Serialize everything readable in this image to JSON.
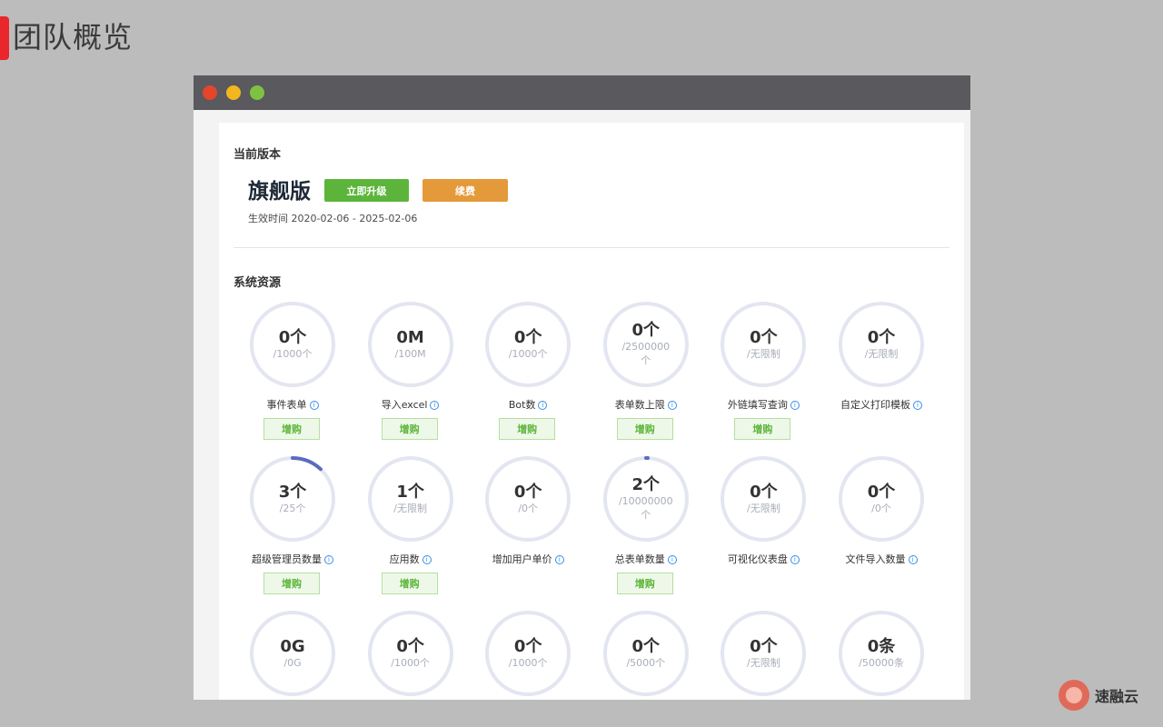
{
  "slide": {
    "title": "团队概览"
  },
  "edition": {
    "section_title": "当前版本",
    "name": "旗舰版",
    "upgrade_label": "立即升级",
    "renew_label": "续费",
    "effective": "生效时间 2020-02-06 - 2025-02-06"
  },
  "resources": {
    "section_title": "系统资源",
    "buy_label": "增购",
    "info_icon": "ⓘ",
    "items": [
      {
        "value": "0个",
        "limit": "/1000个",
        "label": "事件表单",
        "buy": true,
        "progress": 0
      },
      {
        "value": "0M",
        "limit": "/100M",
        "label": "导入excel",
        "buy": true,
        "progress": 0
      },
      {
        "value": "0个",
        "limit": "/1000个",
        "label": "Bot数",
        "buy": true,
        "progress": 0
      },
      {
        "value": "0个",
        "limit": "/2500000个",
        "label": "表单数上限",
        "buy": true,
        "progress": 0
      },
      {
        "value": "0个",
        "limit": "/无限制",
        "label": "外链填写查询",
        "buy": true,
        "progress": 0
      },
      {
        "value": "0个",
        "limit": "/无限制",
        "label": "自定义打印模板",
        "buy": false,
        "progress": 0
      },
      {
        "value": "3个",
        "limit": "/25个",
        "label": "超级管理员数量",
        "buy": true,
        "progress": 0.12
      },
      {
        "value": "1个",
        "limit": "/无限制",
        "label": "应用数",
        "buy": true,
        "progress": 0
      },
      {
        "value": "0个",
        "limit": "/0个",
        "label": "增加用户单价",
        "buy": false,
        "progress": 0
      },
      {
        "value": "2个",
        "limit": "/10000000个",
        "label": "总表单数量",
        "buy": true,
        "progress": 0.002
      },
      {
        "value": "0个",
        "limit": "/无限制",
        "label": "可视化仪表盘",
        "buy": false,
        "progress": 0
      },
      {
        "value": "0个",
        "limit": "/0个",
        "label": "文件导入数量",
        "buy": false,
        "progress": 0
      },
      {
        "value": "0G",
        "limit": "/0G",
        "label": "",
        "buy": false,
        "progress": 0
      },
      {
        "value": "0个",
        "limit": "/1000个",
        "label": "",
        "buy": false,
        "progress": 0
      },
      {
        "value": "0个",
        "limit": "/1000个",
        "label": "",
        "buy": false,
        "progress": 0
      },
      {
        "value": "0个",
        "limit": "/5000个",
        "label": "",
        "buy": false,
        "progress": 0
      },
      {
        "value": "0个",
        "limit": "/无限制",
        "label": "",
        "buy": false,
        "progress": 0
      },
      {
        "value": "0条",
        "limit": "/50000条",
        "label": "",
        "buy": false,
        "progress": 0
      }
    ]
  },
  "brand": {
    "name": "速融云"
  },
  "colors": {
    "ring_track": "#e3e6f0",
    "ring_progress": "#5b6bc0"
  }
}
